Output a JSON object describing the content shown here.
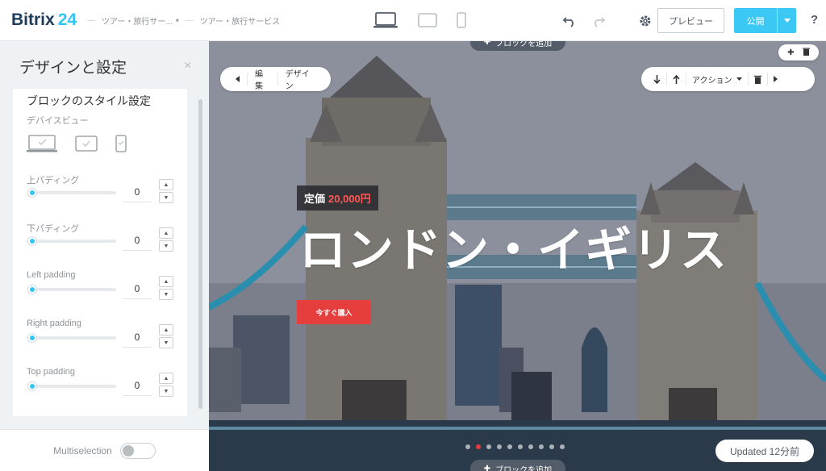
{
  "app": {
    "brand": "Bitrix",
    "brand_num": "24"
  },
  "breadcrumb": {
    "item1": "ツアー・旅行サー...",
    "item2": "ツアー・旅行サービス"
  },
  "toolbar": {
    "preview_label": "プレビュー",
    "publish_label": "公開",
    "help_label": "?"
  },
  "panel": {
    "title": "デザインと設定",
    "close_label": "×",
    "section_title": "ブロックのスタイル設定",
    "device_preview_label": "デバイスビュー",
    "fields": [
      {
        "label": "上パディング",
        "value": "0"
      },
      {
        "label": "下パディング",
        "value": "0"
      },
      {
        "label": "Left padding",
        "value": "0"
      },
      {
        "label": "Right padding",
        "value": "0"
      },
      {
        "label": "Top padding",
        "value": "0"
      }
    ],
    "multiselection_label": "Multiselection"
  },
  "canvas": {
    "add_block_top": "ブロックを追加",
    "add_block_bottom": "ブロックを追加",
    "edit_label": "編集",
    "design_label": "デザイン",
    "actions_label": "アクション",
    "price_prefix": "定価",
    "price_amount": "20,000円",
    "headline": "ロンドン・イギリス",
    "buy_label": "今すぐ購入",
    "updated_label": "Updated 12分前",
    "slide_count": 10,
    "active_slide": 2
  },
  "colors": {
    "accent": "#2fc6f6",
    "publish": "#3bc8f5",
    "buy": "#e63d3d",
    "price": "#ff5752"
  }
}
